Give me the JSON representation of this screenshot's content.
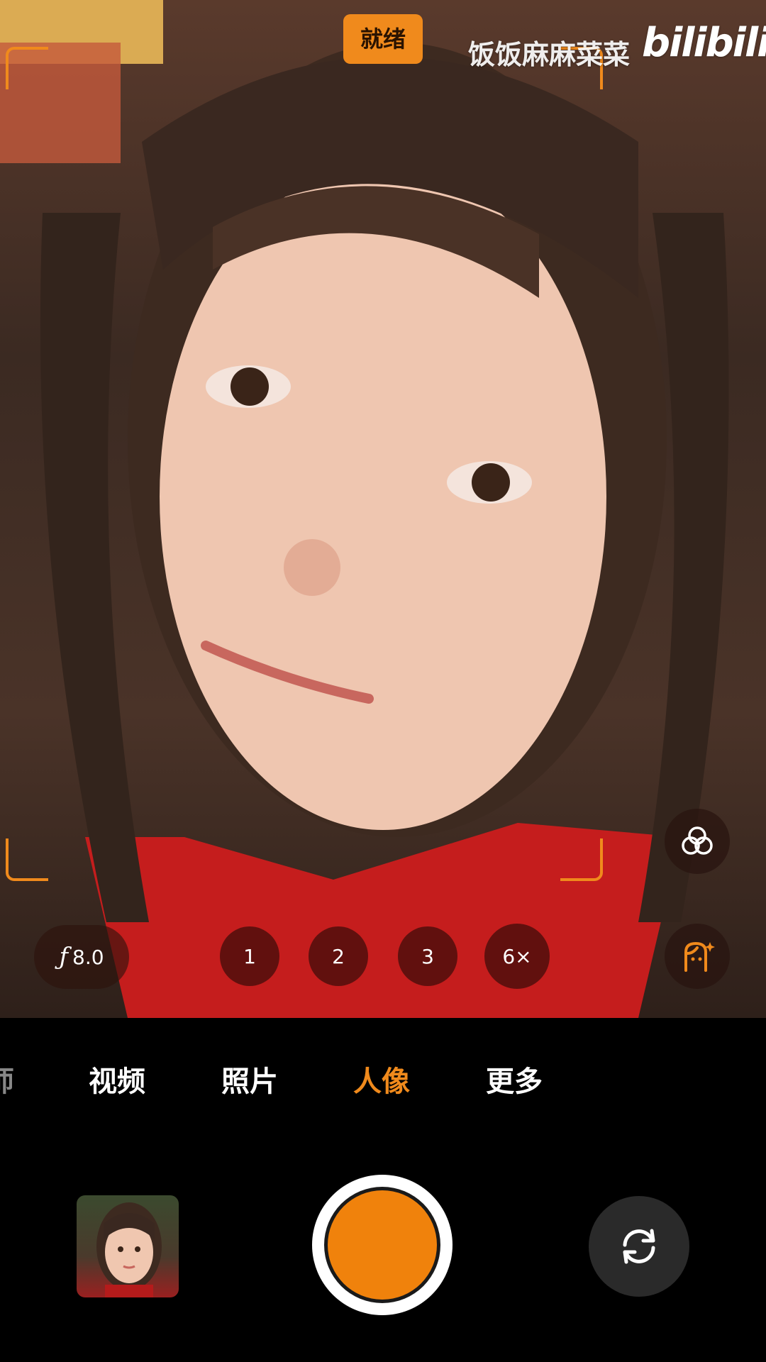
{
  "status": {
    "ready_label": "就绪"
  },
  "watermark": {
    "channel": "饭饭麻麻菜菜",
    "brand": "bilibili"
  },
  "controls": {
    "aperture": {
      "symbol": "ƒ",
      "value": "8.0"
    },
    "zoom_levels": [
      "1",
      "2",
      "3",
      "6×"
    ],
    "filters_icon": "filters-icon",
    "beauty_icon": "beauty-face-icon"
  },
  "modes": {
    "partial_label": "师",
    "items": [
      "视频",
      "照片",
      "人像",
      "更多"
    ],
    "active": "人像"
  },
  "bottom": {
    "gallery_icon": "gallery-thumbnail",
    "shutter_icon": "shutter-button",
    "switch_icon": "switch-camera-icon"
  },
  "colors": {
    "accent": "#f08a1c",
    "background": "#000000"
  }
}
